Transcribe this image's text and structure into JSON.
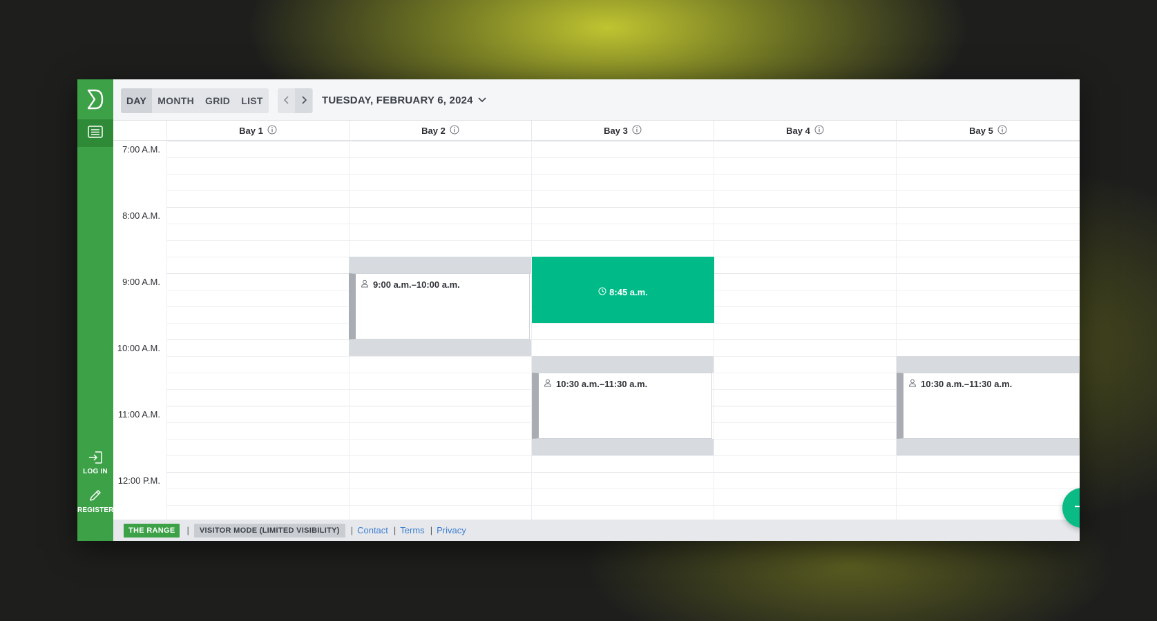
{
  "colors": {
    "sidebar": "#3da147",
    "accent_event": "#00bb88",
    "fab": "#0bbb85",
    "buffer": "#d7dbdf",
    "link": "#3f7fd1"
  },
  "sidebar": {
    "logo_icon": "range-logo-icon",
    "list_icon": "list-icon",
    "login_label": "LOG IN",
    "register_label": "REGISTER"
  },
  "toolbar": {
    "views": [
      "DAY",
      "MONTH",
      "GRID",
      "LIST"
    ],
    "active_view": "DAY",
    "prev_icon": "chevron-left-icon",
    "next_icon": "chevron-right-icon",
    "date_title": "TUESDAY, FEBRUARY 6, 2024"
  },
  "bays": [
    "Bay 1",
    "Bay 2",
    "Bay 3",
    "Bay 4",
    "Bay 5"
  ],
  "times": [
    "7:00 A.M.",
    "8:00 A.M.",
    "9:00 A.M.",
    "10:00 A.M.",
    "11:00 A.M.",
    "12:00 P.M."
  ],
  "events": [
    {
      "bay": "Bay 2",
      "label": "9:00 a.m.–10:00 a.m.",
      "type": "booking"
    },
    {
      "bay": "Bay 3",
      "label": "8:45 a.m.",
      "type": "now-slot"
    },
    {
      "bay": "Bay 3",
      "label": "10:30 a.m.–11:30 a.m.",
      "type": "booking"
    },
    {
      "bay": "Bay 5",
      "label": "10:30 a.m.–11:30 a.m.",
      "type": "booking"
    }
  ],
  "footer": {
    "range_badge": "THE RANGE",
    "mode_badge": "VISITOR MODE (LIMITED VISIBILITY)",
    "links": [
      "Contact",
      "Terms",
      "Privacy"
    ]
  }
}
